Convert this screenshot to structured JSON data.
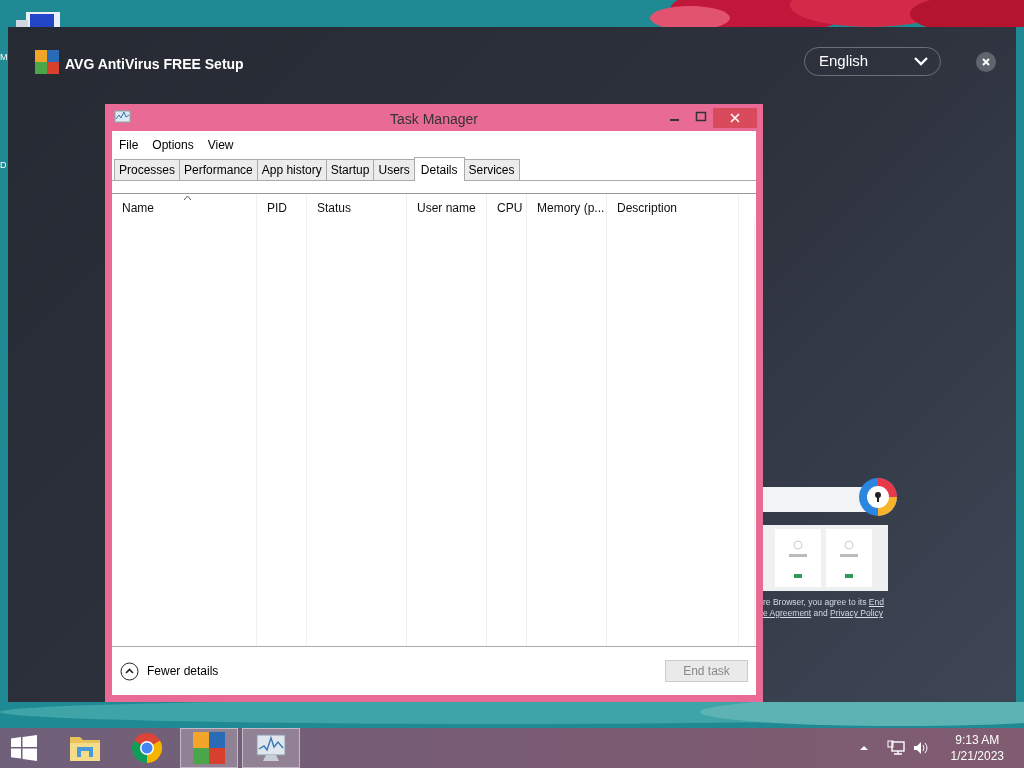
{
  "desktop": {
    "icon_labels": [
      "M",
      "D"
    ]
  },
  "setup_window": {
    "title": "AVG AntiVirus FREE Setup",
    "language": "English",
    "notice_lines": [
      [
        {
          "text": "re Browser, you agree to its ",
          "link": false
        },
        {
          "text": "End",
          "link": true
        }
      ],
      [
        {
          "text": "e Agreement",
          "link": true
        },
        {
          "text": " and ",
          "link": false
        },
        {
          "text": "Privacy Policy",
          "link": true
        }
      ]
    ]
  },
  "task_manager": {
    "title": "Task Manager",
    "menu": [
      "File",
      "Options",
      "View"
    ],
    "tabs": [
      {
        "label": "Processes",
        "selected": false
      },
      {
        "label": "Performance",
        "selected": false
      },
      {
        "label": "App history",
        "selected": false
      },
      {
        "label": "Startup",
        "selected": false
      },
      {
        "label": "Users",
        "selected": false
      },
      {
        "label": "Details",
        "selected": true
      },
      {
        "label": "Services",
        "selected": false
      }
    ],
    "columns": [
      {
        "label": "Name",
        "sorted": true
      },
      {
        "label": "PID",
        "sorted": false
      },
      {
        "label": "Status",
        "sorted": false
      },
      {
        "label": "User name",
        "sorted": false
      },
      {
        "label": "CPU",
        "sorted": false
      },
      {
        "label": "Memory (p...",
        "sorted": false
      },
      {
        "label": "Description",
        "sorted": false
      }
    ],
    "fewer_details": "Fewer details",
    "end_task": {
      "label": "End task",
      "disabled": true
    }
  },
  "taskbar": {
    "apps": [
      {
        "kind": "start",
        "active": false
      },
      {
        "kind": "explorer",
        "active": false
      },
      {
        "kind": "chrome",
        "active": false
      },
      {
        "kind": "avg",
        "active": true
      },
      {
        "kind": "taskmgr",
        "active": true
      }
    ],
    "time": "9:13 AM",
    "date": "1/21/2023"
  }
}
